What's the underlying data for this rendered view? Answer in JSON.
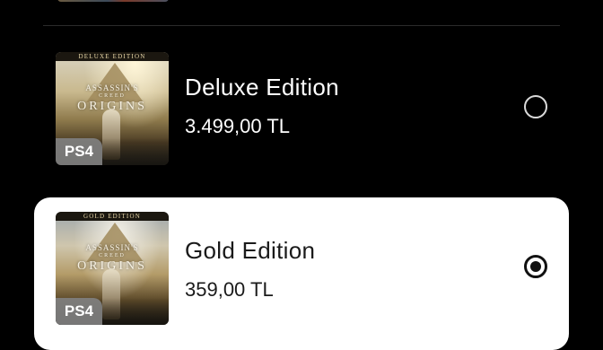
{
  "editions": [
    {
      "name": "Deluxe Edition",
      "price": "3.499,00 TL",
      "selected": false,
      "cover_band": "DELUXE EDITION",
      "platform": "PS4"
    },
    {
      "name": "Gold Edition",
      "price": "359,00 TL",
      "selected": true,
      "cover_band": "GOLD EDITION",
      "platform": "PS4"
    }
  ],
  "cover_logo": {
    "line1": "ASSASSIN'S",
    "line2": "CREED",
    "line3": "ORIGINS"
  },
  "colors": {
    "background": "#000000",
    "selected_card": "#ffffff",
    "platform_badge": "#808080"
  },
  "icons": {
    "radio_unselected": "radio-empty-icon",
    "radio_selected": "radio-filled-icon"
  }
}
